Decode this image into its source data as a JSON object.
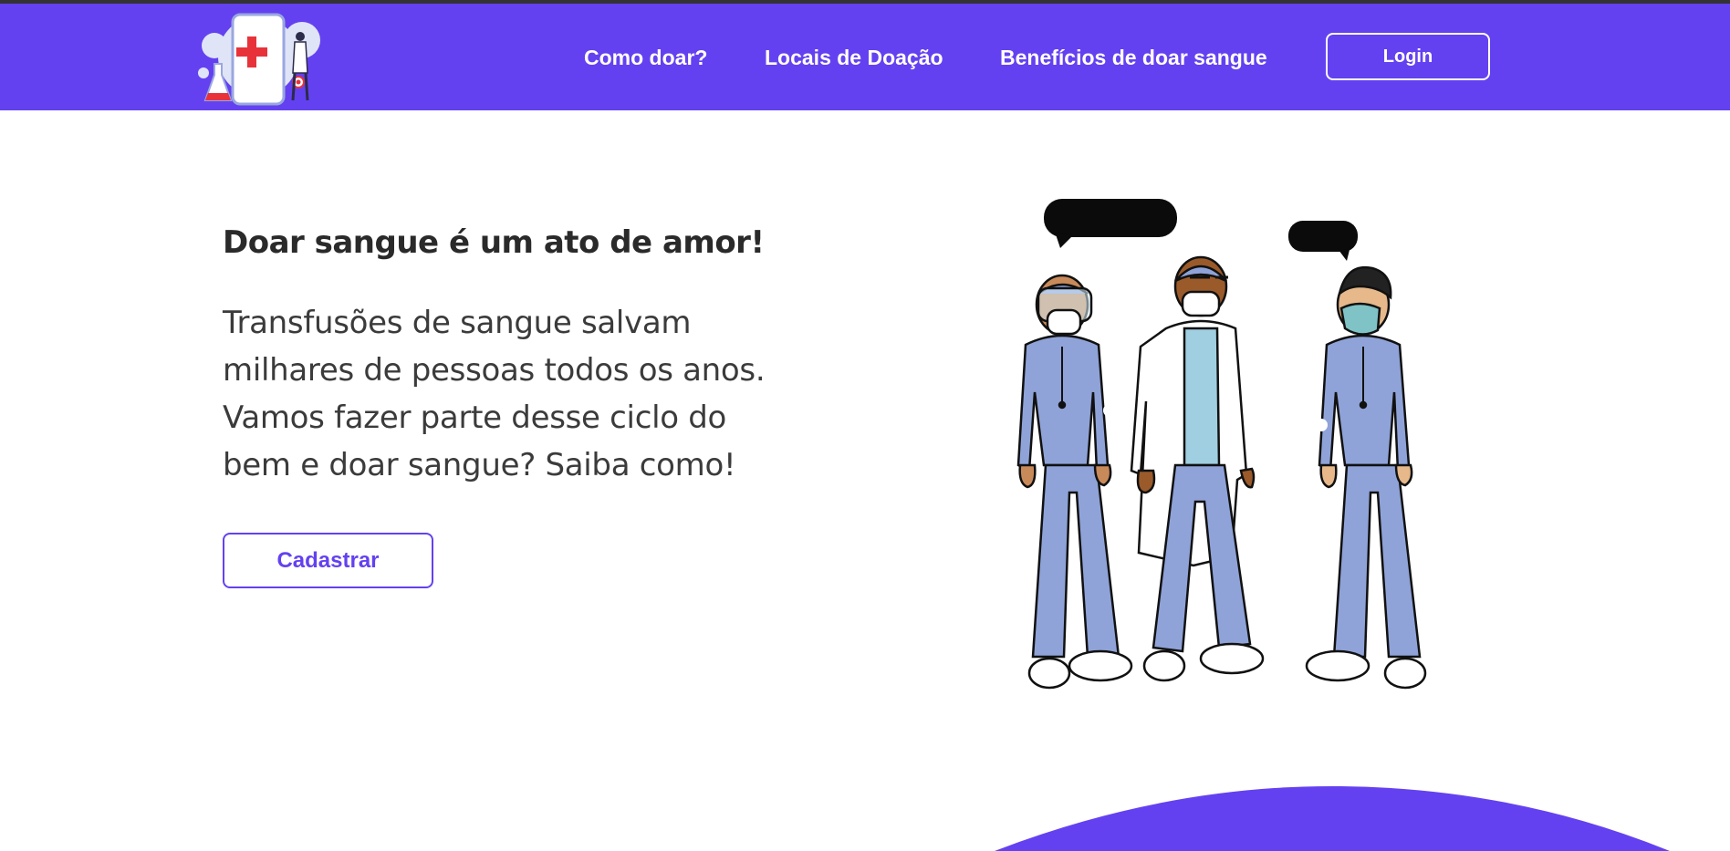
{
  "nav": {
    "logo_icon": "medical-app-logo-icon",
    "links": [
      "Como doar?",
      "Locais de Doação",
      "Benefícios de doar sangue"
    ],
    "login_label": "Login"
  },
  "hero": {
    "title": "Doar sangue é um ato de amor!",
    "text": "Transfusões de sangue salvam milhares de pessoas todos os anos. Vamos fazer parte desse ciclo do bem e doar sangue? Saiba como!",
    "cta_label": "Cadastrar",
    "illustration": "health-workers-illustration"
  },
  "colors": {
    "brand": "#6441f0",
    "scrubs": "#8fa3d8",
    "text_dark": "#2a2a2a"
  }
}
